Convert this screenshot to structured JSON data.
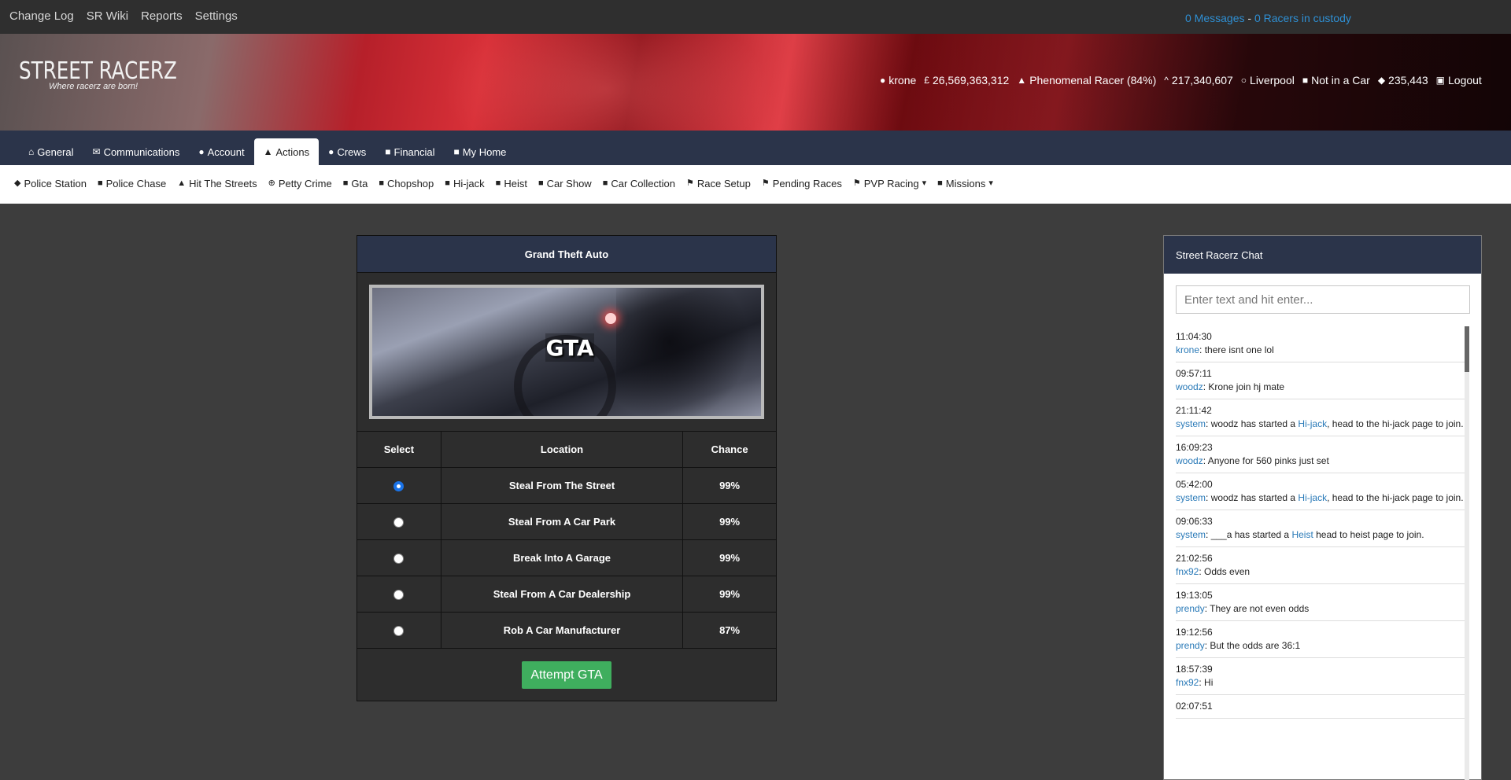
{
  "topnav": {
    "items": [
      "Change Log",
      "SR Wiki",
      "Reports",
      "Settings"
    ]
  },
  "topright": {
    "messages": "0 Messages",
    "separator": " - ",
    "custody": "0 Racers in custody"
  },
  "banner": {
    "logo_title": "STREET RACERZ",
    "logo_subtitle": "Where racerz are born!",
    "stats": {
      "username": "krone",
      "money": "26,569,363,312",
      "rank": "Phenomenal Racer (84%)",
      "points": "217,340,607",
      "location": "Liverpool",
      "car": "Not in a Car",
      "diamonds": "235,443",
      "logout": "Logout"
    }
  },
  "mainnav": {
    "tabs": [
      "General",
      "Communications",
      "Account",
      "Actions",
      "Crews",
      "Financial",
      "My Home"
    ],
    "active": "Actions"
  },
  "subnav": {
    "items": [
      "Police Station",
      "Police Chase",
      "Hit The Streets",
      "Petty Crime",
      "Gta",
      "Chopshop",
      "Hi-jack",
      "Heist",
      "Car Show",
      "Car Collection",
      "Race Setup",
      "Pending Races",
      "PVP Racing",
      "Missions"
    ]
  },
  "gta": {
    "title": "Grand Theft Auto",
    "image_label": "GTA",
    "headers": {
      "select": "Select",
      "location": "Location",
      "chance": "Chance"
    },
    "rows": [
      {
        "location": "Steal From The Street",
        "chance": "99%",
        "selected": true
      },
      {
        "location": "Steal From A Car Park",
        "chance": "99%",
        "selected": false
      },
      {
        "location": "Break Into A Garage",
        "chance": "99%",
        "selected": false
      },
      {
        "location": "Steal From A Car Dealership",
        "chance": "99%",
        "selected": false
      },
      {
        "location": "Rob A Car Manufacturer",
        "chance": "87%",
        "selected": false
      }
    ],
    "button": "Attempt GTA"
  },
  "chat": {
    "title": "Street Racerz Chat",
    "placeholder": "Enter text and hit enter...",
    "messages": [
      {
        "time": "11:04:30",
        "user": "krone",
        "text": "there isnt one lol"
      },
      {
        "time": "09:57:11",
        "user": "woodz",
        "text": "Krone join hj mate"
      },
      {
        "time": "21:11:42",
        "user": "system",
        "pre": "woodz has started a ",
        "link": "Hi-jack",
        "post": ", head to the hi-jack page to join."
      },
      {
        "time": "16:09:23",
        "user": "woodz",
        "text": "Anyone for 560 pinks just set"
      },
      {
        "time": "05:42:00",
        "user": "system",
        "pre": "woodz has started a ",
        "link": "Hi-jack",
        "post": ", head to the hi-jack page to join."
      },
      {
        "time": "09:06:33",
        "user": "system",
        "pre": "___a has started a ",
        "link": "Heist",
        "post": " head to heist page to join."
      },
      {
        "time": "21:02:56",
        "user": "fnx92",
        "text": "Odds even"
      },
      {
        "time": "19:13:05",
        "user": "prendy",
        "text": "They are not even odds"
      },
      {
        "time": "19:12:56",
        "user": "prendy",
        "text": "But the odds are 36:1"
      },
      {
        "time": "18:57:39",
        "user": "fnx92",
        "text": "Hi"
      },
      {
        "time": "02:07:51",
        "user": "",
        "text": ""
      }
    ]
  }
}
